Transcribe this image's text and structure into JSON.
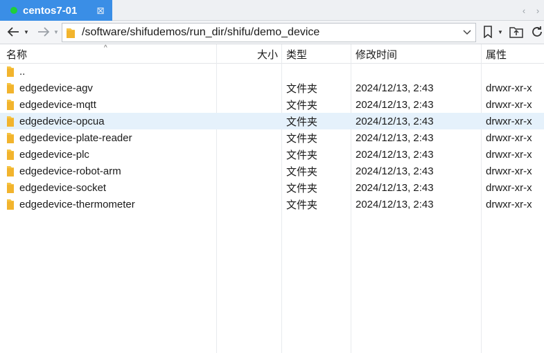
{
  "tabbar": {
    "tab_title": "centos7-01",
    "close_glyph": "⊠",
    "status_color": "#1fcf3a",
    "prev_glyph": "‹",
    "next_glyph": "›"
  },
  "toolbar": {
    "back_icon": "arrow-left-icon",
    "forward_icon": "arrow-right-icon",
    "path_value": "/software/shifudemos/run_dir/shifu/demo_device",
    "bookmark_icon": "bookmark-icon",
    "new_folder_icon": "new-folder-icon",
    "refresh_icon": "refresh-icon"
  },
  "columns": {
    "name": "名称",
    "size": "大小",
    "type": "类型",
    "modified": "修改时间",
    "attributes": "属性"
  },
  "files": [
    {
      "name": "..",
      "size": "",
      "type": "",
      "modified": "",
      "attributes": ""
    },
    {
      "name": "edgedevice-agv",
      "size": "",
      "type": "文件夹",
      "modified": "2024/12/13, 2:43",
      "attributes": "drwxr-xr-x"
    },
    {
      "name": "edgedevice-mqtt",
      "size": "",
      "type": "文件夹",
      "modified": "2024/12/13, 2:43",
      "attributes": "drwxr-xr-x"
    },
    {
      "name": "edgedevice-opcua",
      "size": "",
      "type": "文件夹",
      "modified": "2024/12/13, 2:43",
      "attributes": "drwxr-xr-x",
      "selected": true
    },
    {
      "name": "edgedevice-plate-reader",
      "size": "",
      "type": "文件夹",
      "modified": "2024/12/13, 2:43",
      "attributes": "drwxr-xr-x"
    },
    {
      "name": "edgedevice-plc",
      "size": "",
      "type": "文件夹",
      "modified": "2024/12/13, 2:43",
      "attributes": "drwxr-xr-x"
    },
    {
      "name": "edgedevice-robot-arm",
      "size": "",
      "type": "文件夹",
      "modified": "2024/12/13, 2:43",
      "attributes": "drwxr-xr-x"
    },
    {
      "name": "edgedevice-socket",
      "size": "",
      "type": "文件夹",
      "modified": "2024/12/13, 2:43",
      "attributes": "drwxr-xr-x"
    },
    {
      "name": "edgedevice-thermometer",
      "size": "",
      "type": "文件夹",
      "modified": "2024/12/13, 2:43",
      "attributes": "drwxr-xr-x"
    }
  ],
  "colors": {
    "tab_active": "#3a8ee6",
    "folder": "#f6c443",
    "selected_row": "#e5f1fb"
  }
}
